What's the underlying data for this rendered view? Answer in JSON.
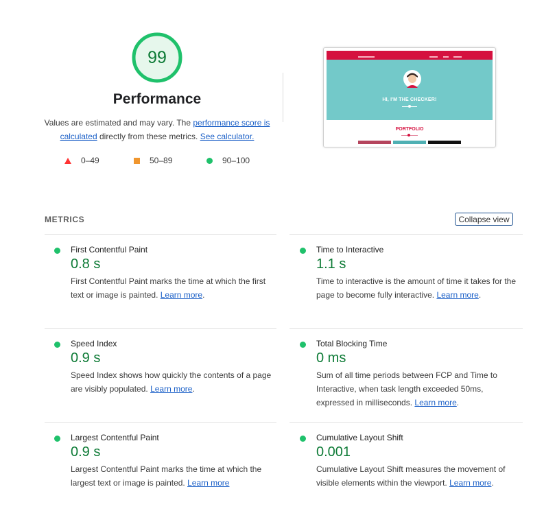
{
  "summary": {
    "score": "99",
    "title": "Performance",
    "desc_pre": "Values are estimated and may vary. The ",
    "desc_link1": "performance score is calculated",
    "desc_mid": " directly from these metrics. ",
    "desc_link2": "See calculator.",
    "legend": [
      {
        "shape": "triangle",
        "color": "#ff3333",
        "label": "0–49"
      },
      {
        "shape": "square",
        "color": "#f0962e",
        "label": "50–89"
      },
      {
        "shape": "circle",
        "color": "#1fc16b",
        "label": "90–100"
      }
    ]
  },
  "screenshot": {
    "hero_text": "HI, I'M THE CHECKER!",
    "portfolio_text": "PORTFOLIO",
    "nav_color": "#d5113f",
    "hero_color": "#73c9c9"
  },
  "metrics": {
    "heading": "METRICS",
    "toggle_label": "Collapse view",
    "learn_more": "Learn more",
    "status_color": "#1fc16b",
    "value_color": "#0c7a35",
    "items": [
      {
        "title": "First Contentful Paint",
        "value": "0.8 s",
        "desc": "First Contentful Paint marks the time at which the first text or image is painted. ",
        "suffix": "."
      },
      {
        "title": "Time to Interactive",
        "value": "1.1 s",
        "desc": "Time to interactive is the amount of time it takes for the page to become fully interactive. ",
        "suffix": "."
      },
      {
        "title": "Speed Index",
        "value": "0.9 s",
        "desc": "Speed Index shows how quickly the contents of a page are visibly populated. ",
        "suffix": "."
      },
      {
        "title": "Total Blocking Time",
        "value": "0 ms",
        "desc": "Sum of all time periods between FCP and Time to Interactive, when task length exceeded 50ms, expressed in milliseconds. ",
        "suffix": "."
      },
      {
        "title": "Largest Contentful Paint",
        "value": "0.9 s",
        "desc": "Largest Contentful Paint marks the time at which the largest text or image is painted. ",
        "suffix": ""
      },
      {
        "title": "Cumulative Layout Shift",
        "value": "0.001",
        "desc": "Cumulative Layout Shift measures the movement of visible elements within the viewport. ",
        "suffix": "."
      }
    ]
  }
}
